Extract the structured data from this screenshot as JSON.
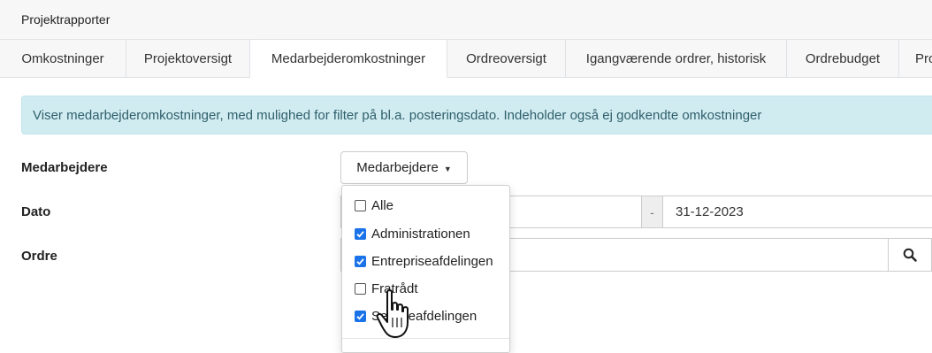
{
  "header": {
    "title": "Projektrapporter"
  },
  "tabs": [
    {
      "label": "Omkostninger"
    },
    {
      "label": "Projektoversigt"
    },
    {
      "label": "Medarbejderomkostninger",
      "active": true
    },
    {
      "label": "Ordreoversigt"
    },
    {
      "label": "Igangværende ordrer, historisk"
    },
    {
      "label": "Ordrebudget"
    },
    {
      "label": "Pro"
    }
  ],
  "alert": {
    "text": "Viser medarbejderomkostninger, med mulighed for filter på bl.a. posteringsdato. Indeholder også ej godkendte omkostninger"
  },
  "form": {
    "employees_label": "Medarbejdere",
    "employees_button": "Medarbejdere",
    "date_label": "Dato",
    "date_separator": "-",
    "date_to": "31-12-2023",
    "order_label": "Ordre"
  },
  "dropdown": {
    "items": [
      {
        "label": "Alle",
        "checked": false
      },
      {
        "label": "Administrationen",
        "checked": true
      },
      {
        "label": "Entrepriseafdelingen",
        "checked": true
      },
      {
        "label": "Fratrådt",
        "checked": false
      },
      {
        "label": "Serviceafdelingen",
        "checked": true
      }
    ]
  },
  "colors": {
    "alert_bg": "#d1ecf1",
    "checkbox_checked": "#1a73e8"
  }
}
